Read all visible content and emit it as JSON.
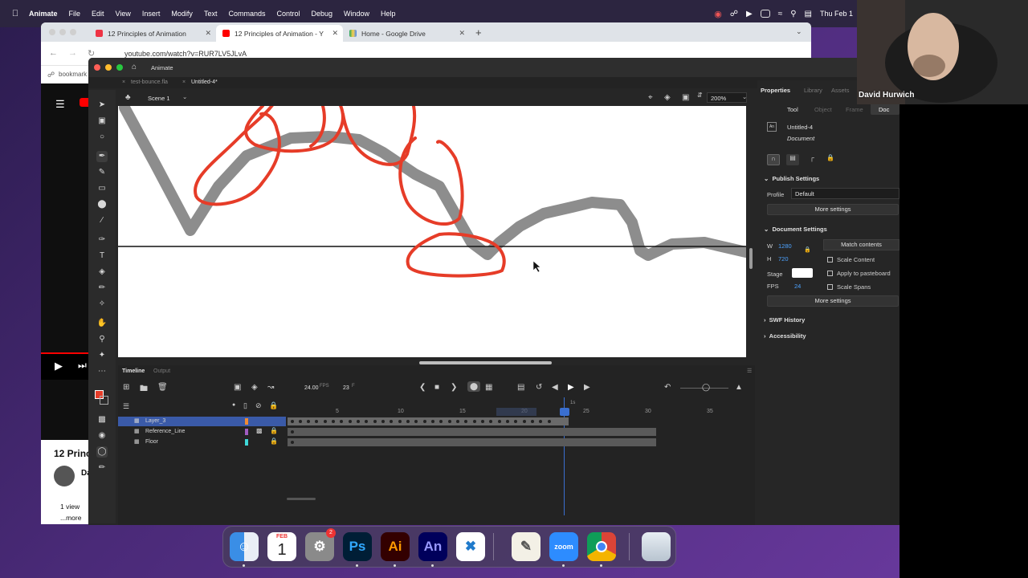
{
  "menubar": {
    "app": "Animate",
    "items": [
      "File",
      "Edit",
      "View",
      "Insert",
      "Modify",
      "Text",
      "Commands",
      "Control",
      "Debug",
      "Window",
      "Help"
    ],
    "clock": "Thu Feb 1"
  },
  "chrome": {
    "tabs": [
      {
        "label": "12 Principles of Animation",
        "favicon": "adobe-icon"
      },
      {
        "label": "12 Principles of Animation - Y",
        "favicon": "youtube-icon"
      },
      {
        "label": "Home - Google Drive",
        "favicon": "drive-icon"
      }
    ],
    "url": "youtube.com/watch?v=RUR7LV5JLvA",
    "bookmark": "bookmark",
    "yt_title_fragment": "12 Princ",
    "yt_channel_fragment": "Da",
    "yt_views": "1 view",
    "yt_more": "...more"
  },
  "animate": {
    "app_title": "Animate",
    "doc_tabs": [
      "test-bounce.fla",
      "Untitled-4*"
    ],
    "scene": "Scene 1",
    "zoom": "200%",
    "timeline": {
      "tabs": [
        "Timeline",
        "Output"
      ],
      "fps": "24.00",
      "fps_unit": "FPS",
      "frame": "23",
      "frame_unit": "F",
      "ruler": [
        "5",
        "10",
        "15",
        "20",
        "25",
        "30",
        "35"
      ],
      "ruler_marker": "1s",
      "layers": [
        "Layer_3",
        "Reference_Line",
        "Floor"
      ]
    },
    "properties": {
      "tabs": [
        "Properties",
        "Library",
        "Assets"
      ],
      "subtabs": [
        "Tool",
        "Object",
        "Frame",
        "Doc"
      ],
      "doc_name": "Untitled-4",
      "doc_type": "Document",
      "publish_header": "Publish Settings",
      "profile_label": "Profile",
      "profile_value": "Default",
      "more_settings": "More settings",
      "doc_settings_header": "Document Settings",
      "w_label": "W",
      "w_value": "1280",
      "h_label": "H",
      "h_value": "720",
      "match_contents": "Match contents",
      "scale_content": "Scale Content",
      "apply_pasteboard": "Apply to pasteboard",
      "stage_label": "Stage",
      "fps_label": "FPS",
      "fps_value": "24",
      "scale_spans": "Scale Spans",
      "swf_history": "SWF History",
      "accessibility": "Accessibility",
      "stroke_color": "#e63c28"
    }
  },
  "webcam": {
    "name": "David Hurwich"
  },
  "dock": {
    "calendar_month": "FEB",
    "calendar_day": "1",
    "settings_badge": "2",
    "apps": [
      "Ps",
      "Ai",
      "An",
      "zoom"
    ]
  }
}
